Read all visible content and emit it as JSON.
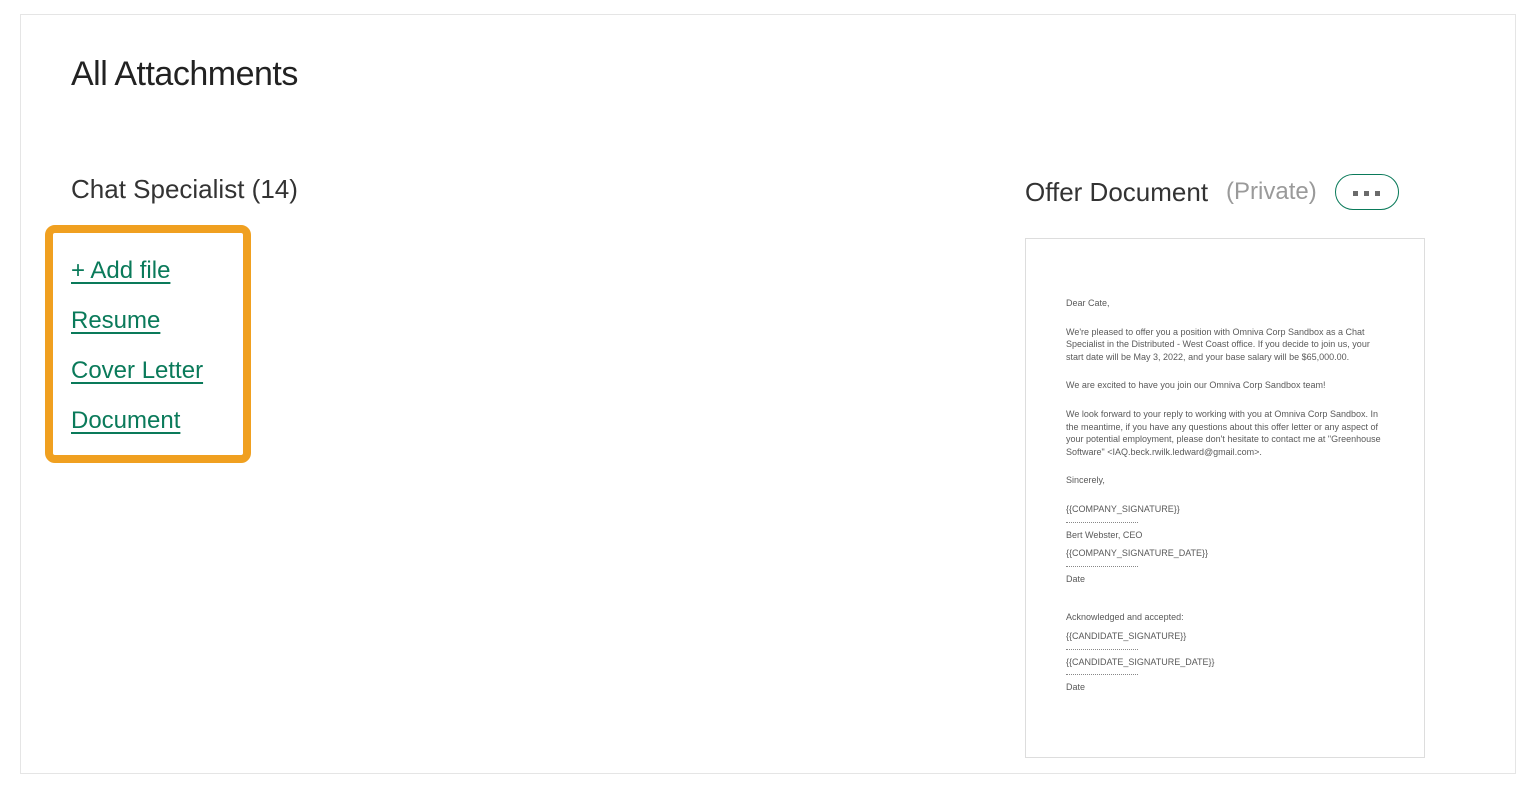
{
  "page_title": "All Attachments",
  "left": {
    "job_title": "Chat Specialist",
    "count": 14,
    "add_file_label": "+ Add file",
    "files": [
      "Resume",
      "Cover Letter",
      "Document"
    ]
  },
  "right": {
    "title": "Offer Document",
    "privacy": "(Private)",
    "preview": {
      "greeting": "Dear Cate,",
      "p1": "We're pleased to offer you a position with Omniva Corp Sandbox as a Chat Specialist in the Distributed - West Coast office. If you decide to join us, your start date will be May 3, 2022, and your base salary will be $65,000.00.",
      "p2": "We are excited to have you join our Omniva Corp Sandbox team!",
      "p3": "We look forward to your reply to working with you at Omniva Corp Sandbox. In the meantime, if you have any questions about this offer letter or any aspect of your potential employment, please don't hesitate to contact me at \"Greenhouse Software\" <IAQ.beck.rwilk.ledward@gmail.com>.",
      "sincerely": "Sincerely,",
      "company_sig": "{{COMPANY_SIGNATURE}}",
      "signer_name": "Bert Webster, CEO",
      "company_sig_date": "{{COMPANY_SIGNATURE_DATE}}",
      "date_label_1": "Date",
      "ack": "Acknowledged and accepted:",
      "cand_sig": "{{CANDIDATE_SIGNATURE}}",
      "cand_sig_date": "{{CANDIDATE_SIGNATURE_DATE}}",
      "date_label_2": "Date"
    }
  }
}
